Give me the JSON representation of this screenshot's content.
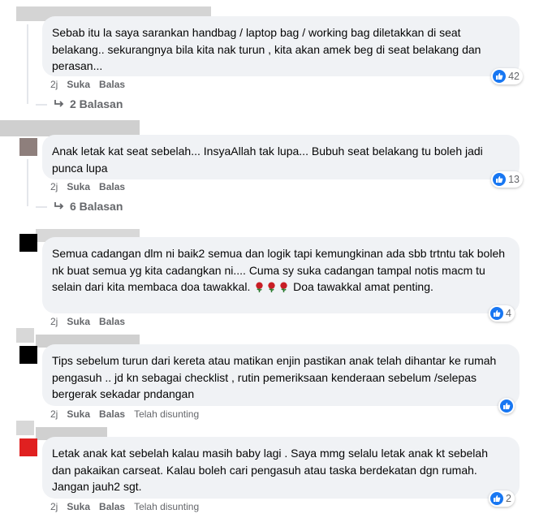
{
  "comments": [
    {
      "text": "Sebab itu la saya sarankan handbag / laptop bag / working bag diletakkan di seat belakang.. sekurangnya bila kita nak turun , kita akan amek beg di seat belakang dan perasan...",
      "time": "2j",
      "like_label": "Suka",
      "reply_label": "Balas",
      "edited": "",
      "reactions": "42",
      "replies": "2 Balasan",
      "avatar_color": "#ffffff"
    },
    {
      "text": "Anak letak kat seat sebelah... InsyaAllah tak lupa... Bubuh seat belakang tu boleh jadi punca lupa",
      "time": "2j",
      "like_label": "Suka",
      "reply_label": "Balas",
      "edited": "",
      "reactions": "13",
      "replies": "6 Balasan",
      "avatar_color": "#8e7f7c"
    },
    {
      "text_before": "Semua cadangan dlm ni baik2 semua dan logik tapi kemungkinan ada sbb trtntu tak boleh nk buat semua yg kita cadangkan ni.... Cuma sy suka cadangan tampal notis macm tu selain dari kita membaca doa tawakkal.",
      "text_after": "Doa tawakkal amat penting.",
      "emoji": "rose-emoji",
      "time": "2j",
      "like_label": "Suka",
      "reply_label": "Balas",
      "edited": "",
      "reactions": "4",
      "avatar_color": "#000000"
    },
    {
      "text": "Tips sebelum turun dari kereta atau matikan enjin pastikan anak telah dihantar ke rumah pengasuh .. jd kn sebagai checklist , rutin pemeriksaan kenderaan sebelum /selepas bergerak sekadar pndangan",
      "time": "2j",
      "like_label": "Suka",
      "reply_label": "Balas",
      "edited": "Telah disunting",
      "reactions": "",
      "avatar_color": "#000000"
    },
    {
      "text": "Letak anak kat sebelah kalau masih baby lagi . Saya mmg selalu letak anak kt sebelah dan pakaikan carseat. Kalau boleh cari pengasuh atau taska berdekatan dgn rumah. Jangan jauh2 sgt.",
      "time": "2j",
      "like_label": "Suka",
      "reply_label": "Balas",
      "edited": "Telah disunting",
      "reactions": "2",
      "avatar_color": "#e02020"
    }
  ],
  "icons": {
    "like": "thumbs-up-icon",
    "reply_arrow": "reply-arrow-icon"
  },
  "colors": {
    "accent": "#1877f2",
    "bubble": "#f0f2f5",
    "secondary_text": "#65676b"
  }
}
